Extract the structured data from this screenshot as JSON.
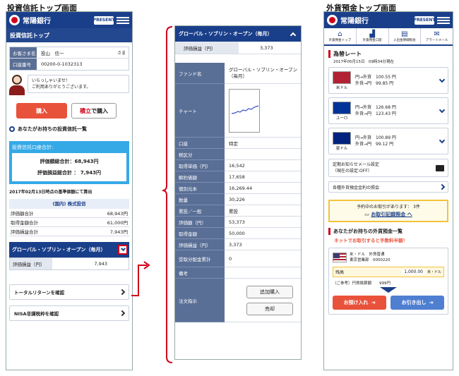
{
  "captions": {
    "left": "投資信託トップ画面",
    "right": "外貨預金トップ画面"
  },
  "brand": {
    "name": "常陽銀行",
    "badge": "PRESENT"
  },
  "left": {
    "title": "投資信託トップ",
    "customer_label": "お客さま名",
    "customer_name": "投山　信一",
    "honorific": "さま",
    "account_label": "口座番号",
    "account_no": "00200-0-1032313",
    "greeting1": "いらっしゃいませ！",
    "greeting2": "ご利用ありがとうございます。",
    "buy": "購入",
    "reserve_a": "積立",
    "reserve_b": " で購入",
    "holdings": "あなたがお持ちの投資信託一覧",
    "total_title": "投資信託口座合計:",
    "eval_total": "評価額総合計：68,943円",
    "pl_total": "評価損益総合計 ： 7,943円",
    "note": "2017年02月13日時点の基準価額にて算出",
    "section": "(国内) 株式投信",
    "rows": [
      {
        "k": "評価額合計",
        "v": "68,943円"
      },
      {
        "k": "取得金額合計",
        "v": "61,000円"
      },
      {
        "k": "評価損益合計",
        "v": "7,943円"
      }
    ],
    "fund": "グローバル・ソブリン・オープン（毎月）",
    "fund_pl_label": "評価損益（円）",
    "fund_pl": "7,943",
    "total_return": "トータルリターンを確認",
    "nisa": "NISA非課税枠を確認"
  },
  "mid": {
    "fund": "グローバル・ソブリン・オープン（毎月）",
    "pl_label": "評価損益（円）",
    "pl": "3,373",
    "fund_name_label": "ファンド名",
    "fund_name": "グローバル・ソブリン・オープン（毎月）",
    "chart_label": "チャート",
    "rows": [
      {
        "k": "口座",
        "v": "特定"
      },
      {
        "k": "税区分",
        "v": ""
      },
      {
        "k": "取得単価（円）",
        "v": "16,542"
      },
      {
        "k": "解約価額",
        "v": "17,658"
      },
      {
        "k": "個別元本",
        "v": "16,269.44"
      },
      {
        "k": "数量",
        "v": "30,226"
      },
      {
        "k": "累投／一般",
        "v": "累投"
      },
      {
        "k": "評価額（円）",
        "v": "53,373"
      },
      {
        "k": "取得金額",
        "v": "50,000"
      },
      {
        "k": "評価損益（円）",
        "v": "3,373"
      },
      {
        "k": "受取分配金累計",
        "v": "0"
      },
      {
        "k": "備考",
        "v": ""
      }
    ],
    "order_label": "注文指示",
    "add_buy": "追加購入",
    "sell": "売却"
  },
  "right": {
    "nav": [
      "外貨預金トップ",
      "外貨預金口座",
      "入出金明細照会",
      "アラートメール"
    ],
    "rate_title": "為替レート",
    "rate_time": "2017年05月15日　09時34分現在",
    "rates": [
      {
        "cur": "米ドル",
        "buy": "円→外貨　100.55 円",
        "sell": "外貨→円　99.85 円",
        "color": "#b22234"
      },
      {
        "cur": "ユーロ",
        "buy": "円→外貨　126.68 円",
        "sell": "外貨→円　123.43 円",
        "color": "#003399"
      },
      {
        "cur": "豪ドル",
        "buy": "円→外貨　100.89 円",
        "sell": "外貨→円　99.12 円",
        "color": "#00247d"
      }
    ],
    "mail1": "定期お知らせメール設定",
    "mail2": "（現在の設定:OFF）",
    "inquiry": "各種外貨預金金利の照会",
    "notice1": "予約中のお取引があります： 3件",
    "notice2": "お取引記録照会 へ",
    "holdings": "あなたがお持ちの外貨預金一覧",
    "promo": "ネットでお取引すると手数料半額！",
    "acct1": "米・ドル　外貨普通",
    "acct2": "東京営業部　0000220",
    "bal_label": "残高",
    "bal": "1,000.00",
    "bal_unit": "米・ドル",
    "ref": "（ご参考）円貨換算額　　999円",
    "deposit": "お預け入れ",
    "withdraw": "お引き出し"
  }
}
